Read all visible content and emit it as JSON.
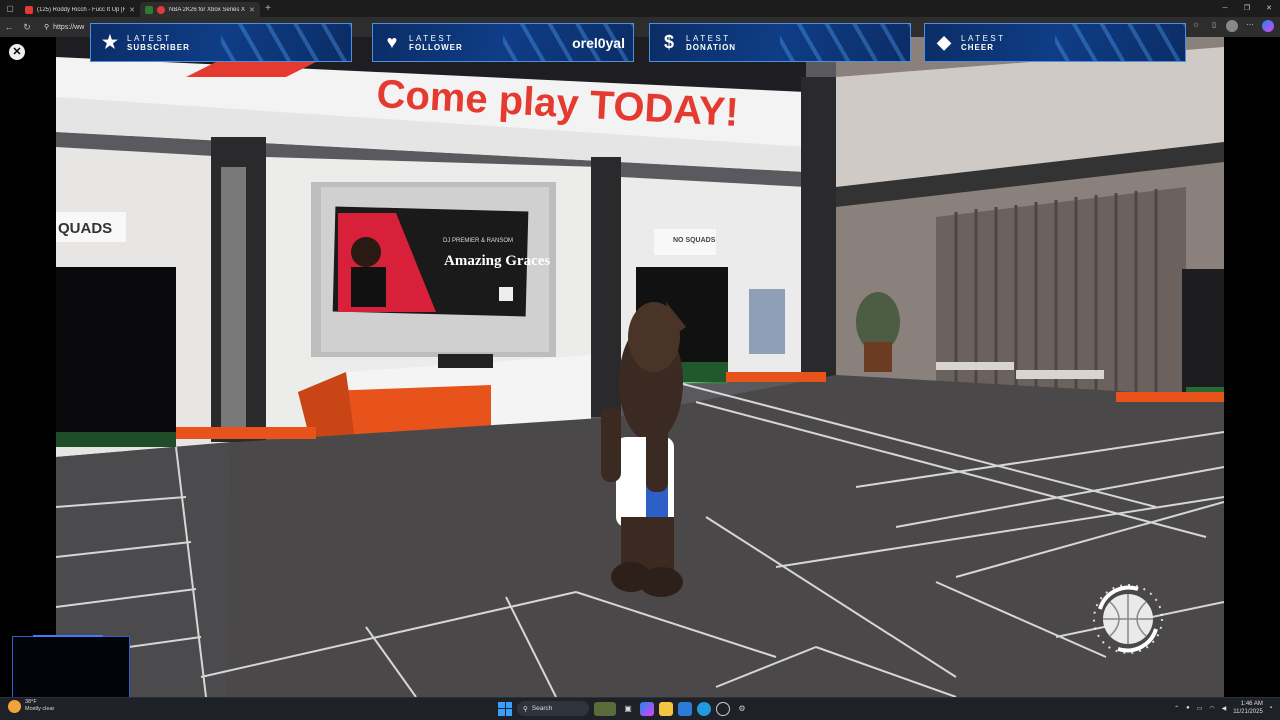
{
  "browser": {
    "tabs": [
      {
        "title": "(125) Roddy Ricch - Fucc It Up [R...",
        "favicon_color": "#e53935",
        "active": false
      },
      {
        "title": "NBA 2K26 for Xbox Series X...",
        "favicon_color": "#2e7d32",
        "active": true
      }
    ],
    "new_tab": "+",
    "url": "https://ww",
    "window_controls": {
      "minimize": "─",
      "restore": "❐",
      "close": "✕"
    }
  },
  "overlay": {
    "alerts": [
      {
        "icon": "star-icon",
        "glyph": "★",
        "line1": "LATEST",
        "line2": "SUBSCRIBER",
        "value": ""
      },
      {
        "icon": "heart-icon",
        "glyph": "♥",
        "line1": "LATEST",
        "line2": "FOLLOWER",
        "value": "orel0yal"
      },
      {
        "icon": "dollar-icon",
        "glyph": "$",
        "line1": "LATEST",
        "line2": "DONATION",
        "value": ""
      },
      {
        "icon": "diamond-icon",
        "glyph": "◆",
        "line1": "LATEST",
        "line2": "CHEER",
        "value": ""
      }
    ]
  },
  "game": {
    "banner_text": "Come play TODAY!",
    "left_sign": "QUADS",
    "door_sign": "NO SQUADS",
    "screen_small": "DJ PREMIER & RANSOM",
    "screen_title": "Amazing Graces",
    "loading_icon": "basketball-loading-icon"
  },
  "taskbar": {
    "weather_temp": "38°F",
    "weather_desc": "Mostly clear",
    "search_label": "Search",
    "time": "1:46 AM",
    "date": "11/21/2025"
  },
  "colors": {
    "alert_bg": "#0f3d86",
    "alert_border": "#4d8fe0",
    "accent_orange": "#e8531c",
    "banner_red": "#e53a30"
  }
}
